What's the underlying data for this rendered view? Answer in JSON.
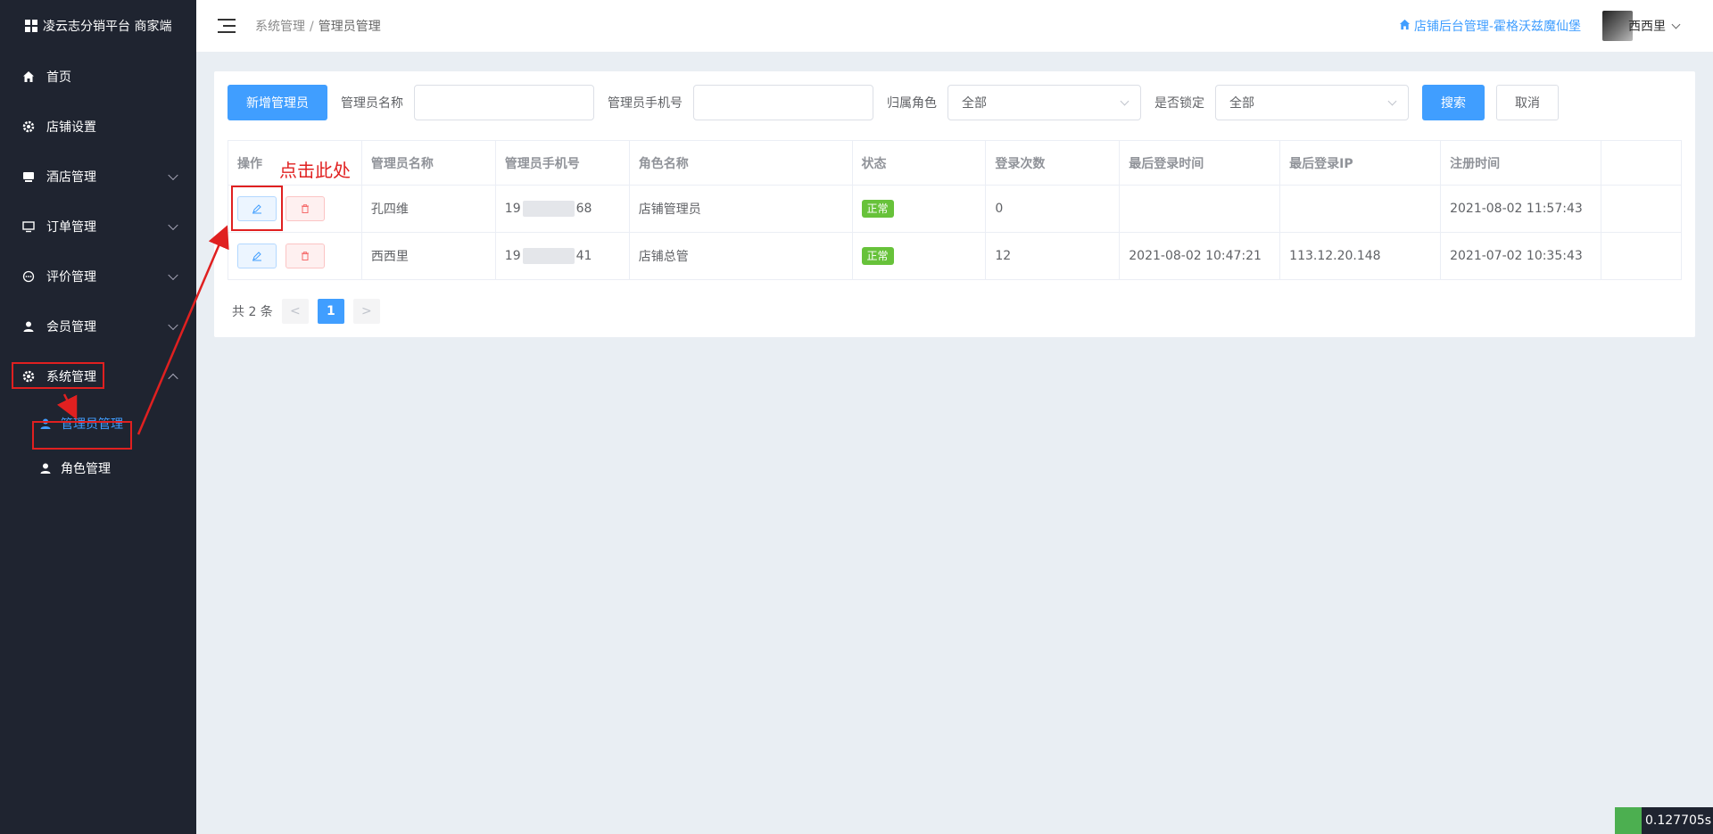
{
  "sidebar": {
    "brand": "凌云志分销平台 商家端",
    "items": [
      {
        "label": "首页"
      },
      {
        "label": "店铺设置"
      },
      {
        "label": "酒店管理"
      },
      {
        "label": "订单管理"
      },
      {
        "label": "评价管理"
      },
      {
        "label": "会员管理"
      },
      {
        "label": "系统管理"
      }
    ],
    "sub_items": [
      {
        "label": "管理员管理",
        "active": true
      },
      {
        "label": "角色管理",
        "active": false
      }
    ]
  },
  "header": {
    "breadcrumb": [
      "系统管理",
      "管理员管理"
    ],
    "shop_link": "店铺后台管理-霍格沃兹魔仙堡",
    "username": "西西里"
  },
  "filter": {
    "add_button": "新增管理员",
    "name_label": "管理员名称",
    "name_value": "",
    "phone_label": "管理员手机号",
    "phone_value": "",
    "role_label": "归属角色",
    "role_value": "全部",
    "lock_label": "是否锁定",
    "lock_value": "全部",
    "search_button": "搜索",
    "cancel_button": "取消"
  },
  "table": {
    "columns": [
      "操作",
      "管理员名称",
      "管理员手机号",
      "角色名称",
      "状态",
      "登录次数",
      "最后登录时间",
      "最后登录IP",
      "注册时间"
    ],
    "rows": [
      {
        "name": "孔四维",
        "phone_prefix": "19",
        "phone_suffix": "68",
        "role": "店铺管理员",
        "status": "正常",
        "login_count": "0",
        "last_login_time": "",
        "last_login_ip": "",
        "register_time": "2021-08-02 11:57:43"
      },
      {
        "name": "西西里",
        "phone_prefix": "19",
        "phone_suffix": "41",
        "role": "店铺总管",
        "status": "正常",
        "login_count": "12",
        "last_login_time": "2021-08-02 10:47:21",
        "last_login_ip": "113.12.20.148",
        "register_time": "2021-07-02 10:35:43"
      }
    ]
  },
  "pagination": {
    "total": "共 2 条",
    "current": "1",
    "prev": "<",
    "next": ">"
  },
  "annotation": {
    "text": "点击此处"
  },
  "perf": {
    "value": "0.127705s"
  },
  "colors": {
    "primary": "#409eff",
    "sidebar_bg": "#1f2430",
    "success": "#67c23a",
    "annotation": "#e02020"
  }
}
